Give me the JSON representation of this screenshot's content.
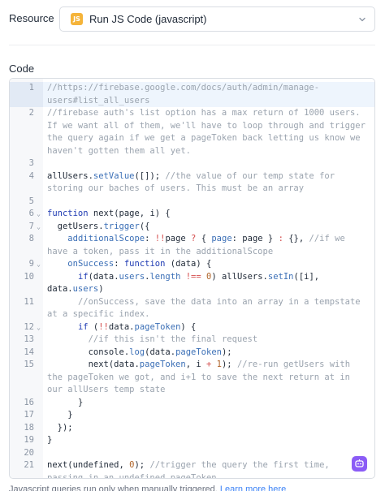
{
  "resource": {
    "label": "Resource",
    "selected": "Run JS Code (javascript)",
    "badge_text": "JS",
    "badge_color": "#f5b43a",
    "chevron_icon": "chevron-down-icon"
  },
  "code": {
    "label": "Code",
    "lines": [
      {
        "n": "1",
        "fold": "",
        "parts": [
          {
            "t": "//https://firebase.google.com/docs/auth/admin/manage-users#list_all_users",
            "c": "cm"
          }
        ]
      },
      {
        "n": "2",
        "fold": "",
        "parts": [
          {
            "t": "//firebase auth's list option has a max return of 1000 users. If we want all of them, we'll have to loop through and trigger the query again if we get a pageToken back letting us know we haven't gotten them all yet.",
            "c": "cm"
          }
        ]
      },
      {
        "n": "3",
        "fold": "",
        "parts": []
      },
      {
        "n": "4",
        "fold": "",
        "parts": [
          {
            "t": "allUsers.",
            "c": "ident"
          },
          {
            "t": "setValue",
            "c": "pr"
          },
          {
            "t": "([]); ",
            "c": "ident"
          },
          {
            "t": "//the value of our temp state for storing our baches of users. This must be an array",
            "c": "cm"
          }
        ]
      },
      {
        "n": "5",
        "fold": "",
        "parts": []
      },
      {
        "n": "6",
        "fold": "⌄",
        "parts": [
          {
            "t": "function ",
            "c": "kw"
          },
          {
            "t": "next(page, i) {",
            "c": "ident"
          }
        ]
      },
      {
        "n": "7",
        "fold": "⌄",
        "parts": [
          {
            "t": "  getUsers.",
            "c": "ident"
          },
          {
            "t": "trigger",
            "c": "pr"
          },
          {
            "t": "({",
            "c": "ident"
          }
        ]
      },
      {
        "n": "8",
        "fold": "",
        "parts": [
          {
            "t": "    additionalScope",
            "c": "pr"
          },
          {
            "t": ": ",
            "c": "ident"
          },
          {
            "t": "!!",
            "c": "op"
          },
          {
            "t": "page ",
            "c": "ident"
          },
          {
            "t": "? ",
            "c": "op"
          },
          {
            "t": "{ ",
            "c": "ident"
          },
          {
            "t": "page",
            "c": "pr"
          },
          {
            "t": ": page } ",
            "c": "ident"
          },
          {
            "t": ": ",
            "c": "op"
          },
          {
            "t": "{}, ",
            "c": "ident"
          },
          {
            "t": "//if we have a token, pass it in the additionalScope",
            "c": "cm"
          }
        ]
      },
      {
        "n": "9",
        "fold": "⌄",
        "parts": [
          {
            "t": "    onSuccess",
            "c": "pr"
          },
          {
            "t": ": ",
            "c": "ident"
          },
          {
            "t": "function ",
            "c": "kw"
          },
          {
            "t": "(data) {",
            "c": "ident"
          }
        ]
      },
      {
        "n": "10",
        "fold": "",
        "parts": [
          {
            "t": "      if",
            "c": "kw"
          },
          {
            "t": "(data.",
            "c": "ident"
          },
          {
            "t": "users",
            "c": "pr"
          },
          {
            "t": ".",
            "c": "ident"
          },
          {
            "t": "length",
            "c": "pr"
          },
          {
            "t": " !== ",
            "c": "op"
          },
          {
            "t": "0",
            "c": "nm"
          },
          {
            "t": ") allUsers.",
            "c": "ident"
          },
          {
            "t": "setIn",
            "c": "pr"
          },
          {
            "t": "([i], data.",
            "c": "ident"
          },
          {
            "t": "users",
            "c": "pr"
          },
          {
            "t": ")",
            "c": "ident"
          }
        ]
      },
      {
        "n": "11",
        "fold": "",
        "parts": [
          {
            "t": "      //onSuccess, save the data into an array in a tempstate at a specific index.",
            "c": "cm"
          }
        ]
      },
      {
        "n": "12",
        "fold": "⌄",
        "parts": [
          {
            "t": "      if ",
            "c": "kw"
          },
          {
            "t": "(",
            "c": "ident"
          },
          {
            "t": "!!",
            "c": "op"
          },
          {
            "t": "data.",
            "c": "ident"
          },
          {
            "t": "pageToken",
            "c": "pr"
          },
          {
            "t": ") {",
            "c": "ident"
          }
        ]
      },
      {
        "n": "13",
        "fold": "",
        "parts": [
          {
            "t": "        //if this isn't the final request",
            "c": "cm"
          }
        ]
      },
      {
        "n": "14",
        "fold": "",
        "parts": [
          {
            "t": "        console.",
            "c": "ident"
          },
          {
            "t": "log",
            "c": "pr"
          },
          {
            "t": "(data.",
            "c": "ident"
          },
          {
            "t": "pageToken",
            "c": "pr"
          },
          {
            "t": ");",
            "c": "ident"
          }
        ]
      },
      {
        "n": "15",
        "fold": "",
        "parts": [
          {
            "t": "        next(data.",
            "c": "ident"
          },
          {
            "t": "pageToken",
            "c": "pr"
          },
          {
            "t": ", i ",
            "c": "ident"
          },
          {
            "t": "+ ",
            "c": "op"
          },
          {
            "t": "1",
            "c": "nm"
          },
          {
            "t": "); ",
            "c": "ident"
          },
          {
            "t": "//re-run getUsers with the pageToken we got, and i+1 to save the next return at in our allUsers temp state",
            "c": "cm"
          }
        ]
      },
      {
        "n": "16",
        "fold": "",
        "parts": [
          {
            "t": "      }",
            "c": "ident"
          }
        ]
      },
      {
        "n": "17",
        "fold": "",
        "parts": [
          {
            "t": "    }",
            "c": "ident"
          }
        ]
      },
      {
        "n": "18",
        "fold": "",
        "parts": [
          {
            "t": "  });",
            "c": "ident"
          }
        ]
      },
      {
        "n": "19",
        "fold": "",
        "parts": [
          {
            "t": "}",
            "c": "ident"
          }
        ]
      },
      {
        "n": "20",
        "fold": "",
        "parts": []
      },
      {
        "n": "21",
        "fold": "",
        "parts": [
          {
            "t": "next(undefined, ",
            "c": "ident"
          },
          {
            "t": "0",
            "c": "nm"
          },
          {
            "t": "); ",
            "c": "ident"
          },
          {
            "t": "//trigger the query the first time, passing in an undefined pageToken",
            "c": "cm"
          }
        ]
      }
    ]
  },
  "assistant": {
    "icon": "ai-assistant-icon",
    "color": "#8b5cf6"
  },
  "footer": {
    "note": "Javascript queries run only when manually triggered.",
    "link": "Learn more here"
  }
}
